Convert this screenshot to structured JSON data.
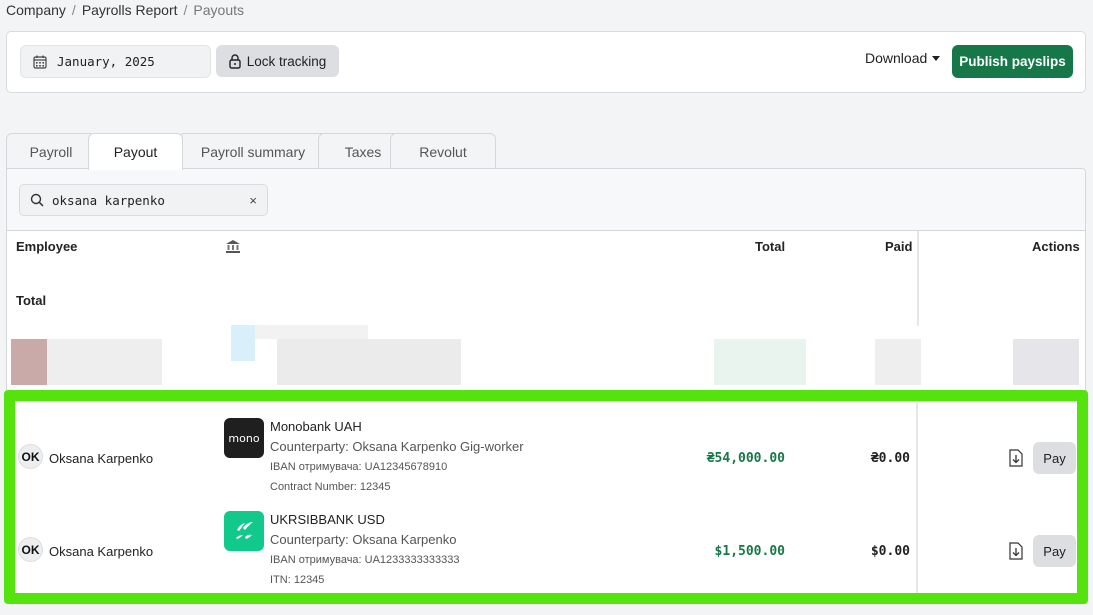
{
  "breadcrumb": {
    "items": [
      "Company",
      "Payrolls Report",
      "Payouts"
    ],
    "separator": "/"
  },
  "toolbar": {
    "month": "January, 2025",
    "lock_label": "Lock tracking",
    "download_label": "Download",
    "publish_label": "Publish payslips"
  },
  "tabs": [
    {
      "label": "Payroll",
      "active": false
    },
    {
      "label": "Payout",
      "active": true
    },
    {
      "label": "Payroll summary",
      "active": false
    },
    {
      "label": "Taxes",
      "active": false
    },
    {
      "label": "Revolut",
      "active": false
    }
  ],
  "search": {
    "value": "oksana karpenko",
    "clear_label": "×"
  },
  "table": {
    "headers": {
      "employee": "Employee",
      "bank_icon": "bank-icon",
      "total": "Total",
      "paid": "Paid",
      "actions": "Actions"
    },
    "total_row_label": "Total",
    "rows": [
      {
        "initials": "OK",
        "name": "Oksana Karpenko",
        "bank_logo": "mono",
        "bank_name": "Monobank UAH",
        "counterparty": "Counterparty: Oksana Karpenko Gig-worker",
        "iban": "IBAN отримувача: UA12345678910",
        "extra": "Contract Number: 12345",
        "total": "₴54,000.00",
        "paid": "₴0.00",
        "pay_label": "Pay"
      },
      {
        "initials": "OK",
        "name": "Oksana Karpenko",
        "bank_logo": "ukrsib",
        "bank_name": "UKRSIBBANK USD",
        "counterparty": "Counterparty: Oksana Karpenko",
        "iban": "IBAN отримувача: UA1233333333333",
        "extra": "ITN: 12345",
        "total": "$1,500.00",
        "paid": "$0.00",
        "pay_label": "Pay"
      }
    ]
  },
  "colors": {
    "accent_green": "#167848",
    "highlight_border": "#55e30e",
    "ukrsib_green": "#10c98a"
  }
}
